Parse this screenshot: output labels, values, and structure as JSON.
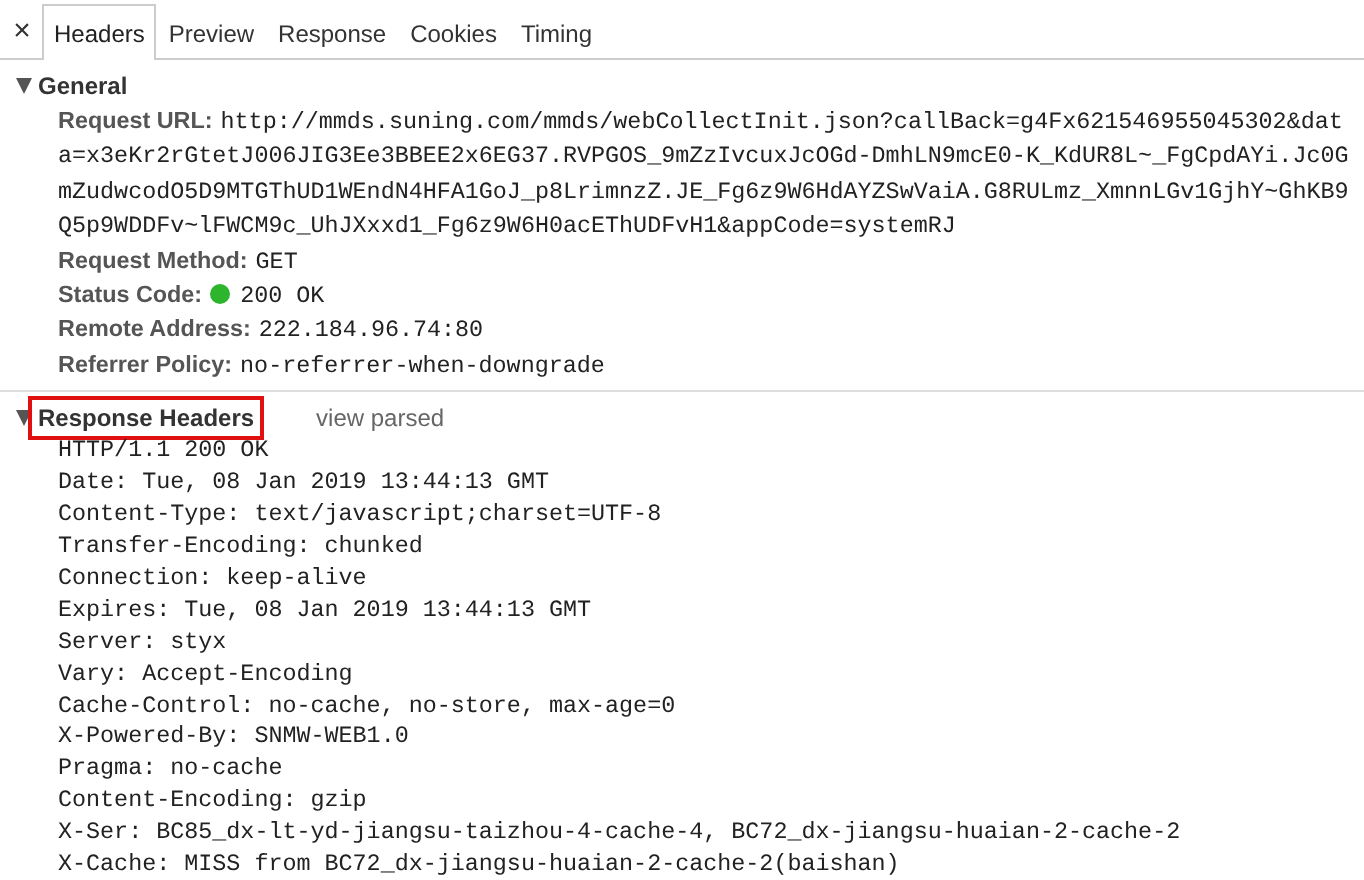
{
  "close_icon": "×",
  "tabs": [
    {
      "label": "Headers",
      "selected": true
    },
    {
      "label": "Preview",
      "selected": false
    },
    {
      "label": "Response",
      "selected": false
    },
    {
      "label": "Cookies",
      "selected": false
    },
    {
      "label": "Timing",
      "selected": false
    }
  ],
  "sections": [
    {
      "kind": "fields",
      "title": "General",
      "expanded": true,
      "highlighted": false,
      "fields": [
        {
          "label": "Request URL:",
          "value": "http://mmds.suning.com/mmds/webCollectInit.json?callBack=g4Fx621546955045302&data=x3eKr2rGtetJ006JIG3Ee3BBEE2x6EG37.RVPGOS_9mZzIvcuxJcOGd-DmhLN9mcE0-K_KdUR8L~_FgCpdAYi.Jc0GmZudwcodO5D9MTGThUD1WEndN4HFA1GoJ_p8LrimnzZ.JE_Fg6z9W6HdAYZSwVaiA.G8RULmz_XmnnLGv1GjhY~GhKB9Q5p9WDDFv~lFWCM9c_UhJXxxd1_Fg6z9W6H0acEThUDFvH1&appCode=systemRJ"
        },
        {
          "label": "Request Method:",
          "value": "GET"
        },
        {
          "label": "Status Code:",
          "value": "200 OK",
          "color": "#2db52d"
        },
        {
          "label": "Remote Address:",
          "value": "222.184.96.74:80"
        },
        {
          "label": "Referrer Policy:",
          "value": "no-referrer-when-downgrade"
        }
      ]
    },
    {
      "kind": "raw",
      "title": "Response Headers",
      "expanded": true,
      "highlighted": true,
      "toggle": "view parsed",
      "lines": [
        "HTTP/1.1 200 OK",
        "Date: Tue, 08 Jan 2019 13:44:13 GMT",
        "Content-Type: text/javascript;charset=UTF-8",
        "Transfer-Encoding: chunked",
        "Connection: keep-alive",
        "Expires: Tue, 08 Jan 2019 13:44:13 GMT",
        "Server: styx",
        "Vary: Accept-Encoding",
        "Cache-Control: no-cache, no-store, max-age=0",
        "X-Powered-By: SNMW-WEB1.0",
        "Pragma: no-cache",
        "Content-Encoding: gzip",
        "X-Ser: BC85_dx-lt-yd-jiangsu-taizhou-4-cache-4, BC72_dx-jiangsu-huaian-2-cache-2",
        "X-Cache: MISS from BC72_dx-jiangsu-huaian-2-cache-2(baishan)"
      ]
    }
  ]
}
